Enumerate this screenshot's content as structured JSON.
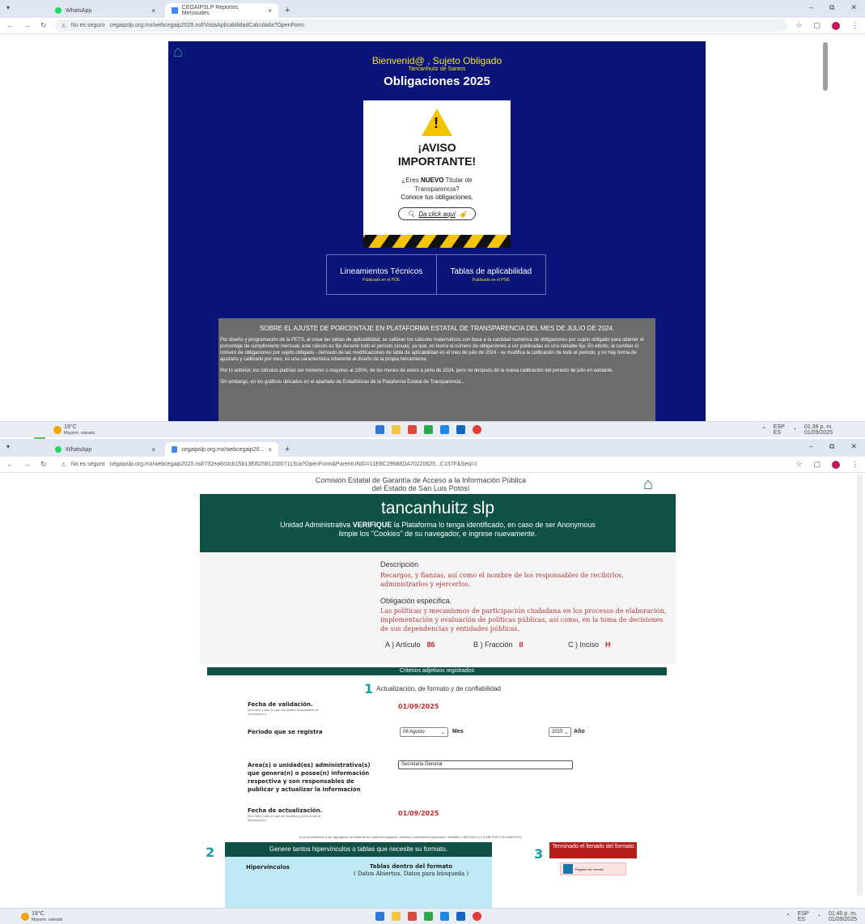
{
  "colors": {
    "panel_blue": "#0b1478",
    "header_green": "#0f5144",
    "accent_red": "#c62828",
    "warning_yellow": "#f5c400"
  },
  "top": {
    "tabs": [
      {
        "label": "WhatsApp",
        "icon": "whatsapp-icon"
      },
      {
        "label": "CEGAIPSLP Reportes Mensuales",
        "icon": "chrome-icon"
      }
    ],
    "address": {
      "security": "No es seguro",
      "url": "cegaipslp.org.mx/webcegaip2025.nsf/VistaAplicabilidadCalculada?OpenForm"
    },
    "page": {
      "welcome": "Bienvenid@ , Sujeto Obligado",
      "municipality": "Tancanhuitz de Santos",
      "obligations_title": "Obligaciones 2025",
      "notice_title_1": "¡AVISO",
      "notice_title_2": "IMPORTANTE!",
      "notice_q1": "¿Eres",
      "notice_q_bold": "NUEVO",
      "notice_q2": "Titular de",
      "notice_q3": "Transparencia?",
      "notice_know": "Conoce tus obligaciones.",
      "notice_click": "Da click aquí",
      "link_1": "Lineamientos Técnicos",
      "link_1_sub": "Publicado en el POE",
      "link_2": "Tablas de aplicabilidad",
      "link_2_sub": "Publicado en el POE",
      "gray_title": "SOBRE EL AJUSTE DE PORCENTAJE EN PLATAFORMA ESTATAL DE TRANSPARENCIA DEL MES DE JULIO DE 2024.",
      "gray_p1": "Por diseño y programación de la PETS, al crear las tablas de aplicabilidad, se calibran los cálculos matemáticos con base a la cantidad numérica de obligaciones por sujeto obligado para obtener el porcentaje de cumplimiento mensual, este cálculo es fijo durante todo el periodo (anual), ya que, en teoría el número de obligaciones a ser publicadas es una variable fija. En efecto, al cambiar el número de obligaciones por sujeto obligado - derivado de las modificaciones de tabla de aplicabilidad en el mes de julio de 2024 - se modifica la calibración de todo el periodo, y no hay forma de ajustarlo y calibrarlo por mes, es una característica inherente al diseño de la propia herramienta.",
      "gray_p2": "Por lo anterior, los cálculos podrían ser menores o mayores al 100%, de los meses de enero a junio de 2024, pero no después de la nueva calibración del periodo de julio en adelante.",
      "gray_p3": "Sin embargo, en los gráficos ubicados en el apartado de Estadísticas de la Plataforma Estatal de Transparencia..."
    },
    "taskbar": {
      "weather": "19°C",
      "weather_sub": "Mayorm. soleado",
      "lang": "ESP",
      "lang_sub": "ES",
      "time": "01:39 p. m.",
      "date": "01/09/2025"
    }
  },
  "bottom": {
    "tabs": [
      {
        "label": "WhatsApp",
        "icon": "whatsapp-icon"
      },
      {
        "label": "cegaipslp.org.mx/webcegaip20...",
        "icon": "chrome-icon"
      }
    ],
    "address": {
      "security": "No es seguro",
      "url": "cegaipslp.org.mx/webcegaip2025.nsf/732ea6c0cb15b13f06258115007113ca?OpenForm&ParentUNID=11E8C29688DA70220625...C157F&Seq=1"
    },
    "page": {
      "commission_1": "Comisión Estatal de Garantía de Acceso a la Información Pública",
      "commission_2": "del Estado de San Luis Potosí",
      "subject": "tancanhuitz slp",
      "msg_1a": "Unidad Administrativa",
      "msg_1b": "VERIFIQUE",
      "msg_1c": "la Plataforma lo tenga identificado, en caso de ser Anonymous",
      "msg_2": "limpie los \"Cookies\" de su navegador, e ingrese nuevamente.",
      "desc_label": "Descripción",
      "desc_text": "Recargos, y fianzas, así como el nombre de los responsables de recibirlos, administrarlos y ejercerlos.",
      "obl_label": "Obligación específica.",
      "obl_text": "Las políticas y mecanismos de participación ciudadana en los procesos de elaboración, implementación y evaluación de políticas públicas, así como, en la toma de decisiones de sus dependencias y entidades públicas.",
      "articulo_label": "A ) Artículo",
      "articulo": "86",
      "fraccion_label": "B ) Fracción",
      "fraccion": "II",
      "inciso_label": "C ) Inciso",
      "inciso": "H",
      "criterios": "Criterios adjetivos registrados",
      "sec1_num": "1",
      "sec1_title": "Actualización, de formato y de confiabilidad",
      "fecha_validacion_label": "Fecha de validación.",
      "fecha_validacion_sub": "(Día mes y año en que se verifica nuevamente la información.)",
      "fecha_validacion": "01/09/2025",
      "periodo_label": "Periodo que se registra",
      "periodo_mes": "08 Agosto",
      "mes_label": "Mes",
      "periodo_anio": "2025",
      "anio_label": "Año",
      "area_label_1": "Área(s) o unidad(es) administrativa(s)",
      "area_label_2": "que genera(n) o posee(n) información",
      "area_label_3": "respectiva y son responsables de",
      "area_label_4": "publicar y actualizar la información",
      "area_value": "Secretaria General",
      "fecha_actualizacion_label": "Fecha de actualización.",
      "fecha_actualizacion_sub": "(Día mes y año en que se modifica y pone al día la información.)",
      "fecha_actualizacion": "01/09/2025",
      "note": "(Los documentos a ser agregados no deberán de contener espacios, acentos o caracteres especiales. TAMAÑO LIMITADO A 1.5 MB POR DOCUMENTO)",
      "sec2_num": "2",
      "sec2_title": "Genere tantos hipervínculos o tablas que necesite su formato.",
      "col_hiper": "Hipervínculos",
      "col_tablas": "Tablas dentro del formato",
      "col_tablas_sub": "( Datos Abiertos, Datos para búsqueda )",
      "sec3_num": "3",
      "sec3_title": "Terminado el llenado del formato",
      "registro": "Registro de formato"
    },
    "taskbar": {
      "weather": "19°C",
      "weather_sub": "Mayorm. soleado",
      "lang": "ESP",
      "lang_sub": "ES",
      "time": "01:40 p. m.",
      "date": "01/09/2025"
    }
  }
}
